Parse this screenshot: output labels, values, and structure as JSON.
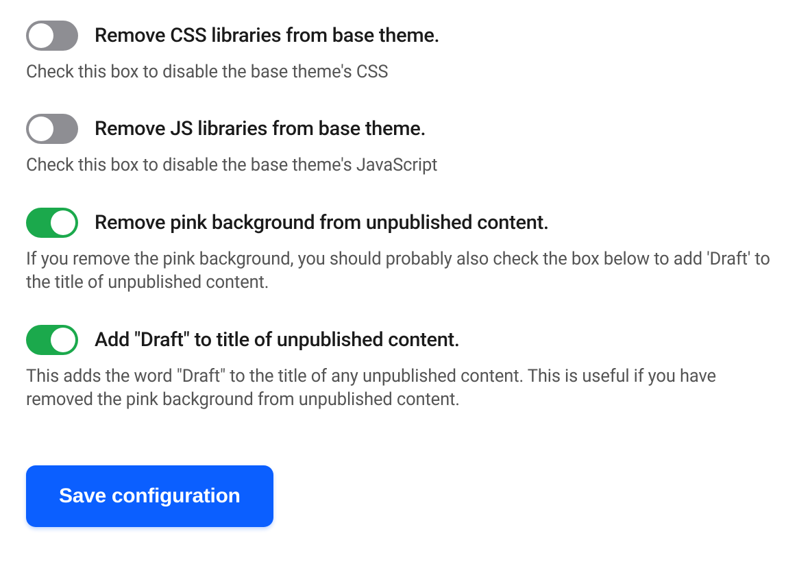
{
  "options": [
    {
      "id": "remove-css",
      "label": "Remove CSS libraries from base theme.",
      "description": "Check this box to disable the base theme's CSS",
      "checked": false
    },
    {
      "id": "remove-js",
      "label": "Remove JS libraries from base theme.",
      "description": "Check this box to disable the base theme's JavaScript",
      "checked": false
    },
    {
      "id": "remove-pink",
      "label": "Remove pink background from unpublished content.",
      "description": "If you remove the pink background, you should probably also check the box below to add 'Draft' to the title of unpublished content.",
      "checked": true
    },
    {
      "id": "add-draft",
      "label": "Add \"Draft\" to title of unpublished content.",
      "description": "This adds the word \"Draft\" to the title of any unpublished content. This is useful if you have removed the pink background from unpublished content.",
      "checked": true
    }
  ],
  "save_label": "Save configuration"
}
